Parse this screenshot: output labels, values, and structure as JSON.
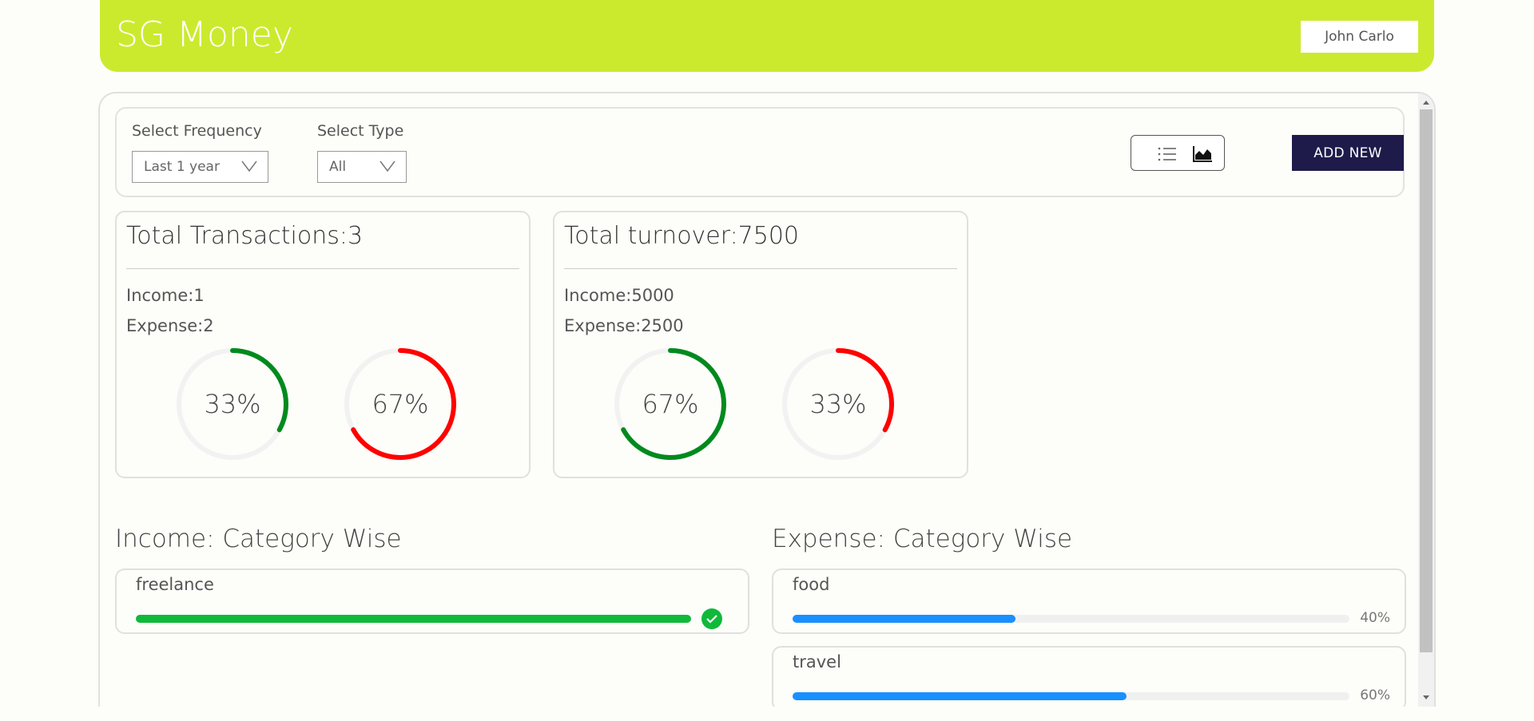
{
  "app": {
    "brand": "SG Money",
    "user": "John Carlo"
  },
  "filters": {
    "frequency_label": "Select Frequency",
    "frequency_value": "Last 1 year",
    "type_label": "Select Type",
    "type_value": "All",
    "add_new": "ADD NEW",
    "view_icons": [
      "list-icon",
      "area-chart-icon"
    ]
  },
  "cards": [
    {
      "title": "Total Transactions:3",
      "line1": "Income:1",
      "line2": "Expense:2",
      "gauges": [
        {
          "label": "33%",
          "value": 0.33,
          "color": "#008a1e"
        },
        {
          "label": "67%",
          "value": 0.67,
          "color": "#ff0000"
        }
      ]
    },
    {
      "title": "Total turnover:7500",
      "line1": "Income:5000",
      "line2": "Expense:2500",
      "gauges": [
        {
          "label": "67%",
          "value": 0.67,
          "color": "#008a1e"
        },
        {
          "label": "33%",
          "value": 0.33,
          "color": "#ff0000"
        }
      ]
    }
  ],
  "income_section": {
    "title": "Income: Category Wise",
    "items": [
      {
        "name": "freelance",
        "value": 1.0,
        "color": "#10b93a",
        "complete": true
      }
    ]
  },
  "expense_section": {
    "title": "Expense: Category Wise",
    "items": [
      {
        "name": "food",
        "value": 0.4,
        "pct": "40%",
        "color": "#1890ff"
      },
      {
        "name": "travel",
        "value": 0.6,
        "pct": "60%",
        "color": "#1890ff"
      }
    ]
  },
  "colors": {
    "header": "#cbea2e",
    "button": "#1e1b4b",
    "income": "#008a1e",
    "expense": "#ff0000"
  }
}
